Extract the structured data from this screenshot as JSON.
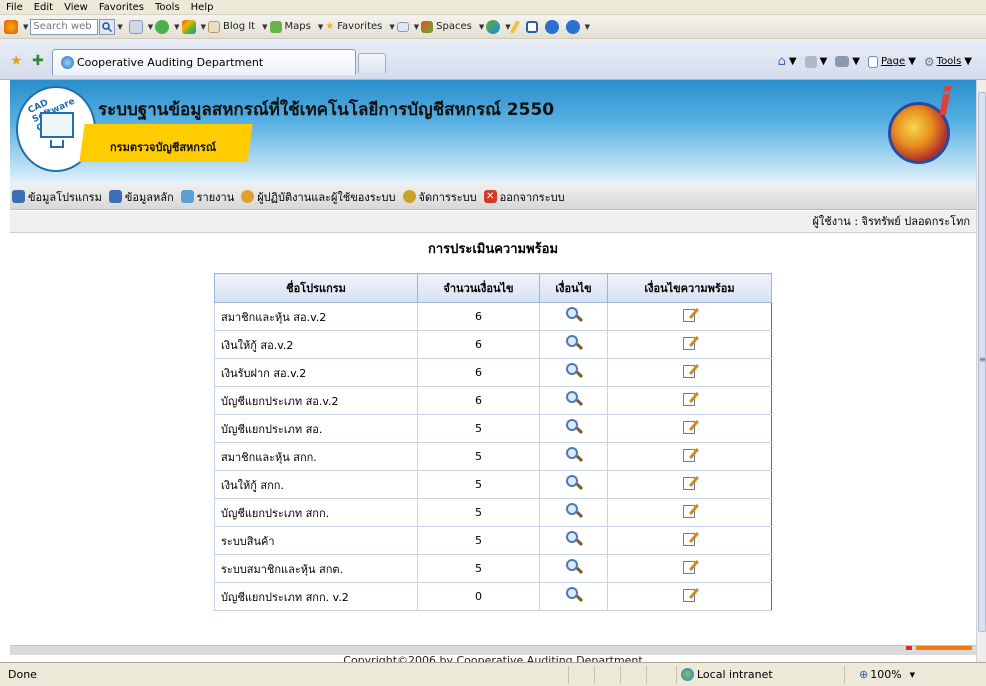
{
  "menubar": {
    "items": [
      "File",
      "Edit",
      "View",
      "Favorites",
      "Tools",
      "Help"
    ]
  },
  "toolbar": {
    "search_placeholder": "Search web",
    "items": [
      "Blog It",
      "Maps",
      "Favorites",
      "Spaces"
    ]
  },
  "tabs": {
    "active_title": "Cooperative Auditing Department"
  },
  "commandbar": {
    "page": "Page",
    "tools": "Tools"
  },
  "banner": {
    "title": "ระบบฐานข้อมูลสหกรณ์ที่ใช้เทคโนโลยีการบัญชีสหกรณ์ 2550",
    "subtitle": "กรมตรวจบัญชีสหกรณ์",
    "logo_text": "CAD Software Center"
  },
  "nav": {
    "items": [
      {
        "label": "ข้อมูลโปรแกรม",
        "color": "#3d6fb5"
      },
      {
        "label": "ข้อมูลหลัก",
        "color": "#3d6fb5"
      },
      {
        "label": "รายงาน",
        "color": "#5a9fd6"
      },
      {
        "label": "ผู้ปฏิบัติงานและผู้ใช้ของระบบ",
        "color": "#e0a030"
      },
      {
        "label": "จัดการระบบ",
        "color": "#c9a227"
      },
      {
        "label": "ออกจากระบบ",
        "color": "#d33a2a"
      }
    ]
  },
  "user": {
    "text": "ผู้ใช้งาน : จิรทรัพย์ ปลอดกระโทก"
  },
  "page": {
    "title": "การประเมินความพร้อม"
  },
  "table": {
    "headers": [
      "ชื่อโปรแกรม",
      "จำนวนเงื่อนไข",
      "เงื่อนไข",
      "เงื่อนไขความพร้อม"
    ],
    "rows": [
      {
        "name": "สมาชิกและหุ้น สอ.v.2",
        "count": "6"
      },
      {
        "name": "เงินให้กู้ สอ.v.2",
        "count": "6"
      },
      {
        "name": "เงินรับฝาก สอ.v.2",
        "count": "6"
      },
      {
        "name": "บัญชีแยกประเภท สอ.v.2",
        "count": "6"
      },
      {
        "name": "บัญชีแยกประเภท สอ.",
        "count": "5"
      },
      {
        "name": "สมาชิกและหุ้น สกก.",
        "count": "5"
      },
      {
        "name": "เงินให้กู้ สกก.",
        "count": "5"
      },
      {
        "name": "บัญชีแยกประเภท สกก.",
        "count": "5"
      },
      {
        "name": "ระบบสินค้า",
        "count": "5"
      },
      {
        "name": "ระบบสมาชิกและหุ้น สกต.",
        "count": "5"
      },
      {
        "name": "บัญชีแยกประเภท สกก. v.2",
        "count": "0"
      }
    ]
  },
  "footer": {
    "copyright": "Copyright©2006 by Cooperative Auditing Department"
  },
  "status": {
    "text": "Done",
    "zone": "Local intranet",
    "zoom": "100%"
  }
}
